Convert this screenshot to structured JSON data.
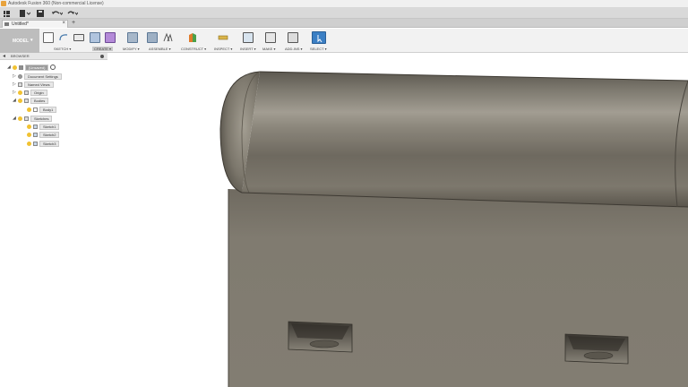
{
  "window": {
    "title": "Autodesk Fusion 360 (Non-commercial License)"
  },
  "document_tab": {
    "label": "Untitled*"
  },
  "ribbon": {
    "workspace": "MODEL",
    "groups": [
      {
        "label": "SKETCH ▾"
      },
      {
        "label": "CREATE ▾"
      },
      {
        "label": "MODIFY ▾"
      },
      {
        "label": "ASSEMBLE ▾"
      },
      {
        "label": "CONSTRUCT ▾"
      },
      {
        "label": "INSPECT ▾"
      },
      {
        "label": "INSERT ▾"
      },
      {
        "label": "MAKE ▾"
      },
      {
        "label": "ADD-INS ▾"
      },
      {
        "label": "SELECT ▾"
      }
    ]
  },
  "browser": {
    "title": "BROWSER",
    "root": "(Unsaved)",
    "items": [
      "Document Settings",
      "Named Views",
      "Origin",
      "Bodies",
      "Body1",
      "Sketches",
      "Sketch1",
      "Sketch2",
      "Sketch3"
    ]
  },
  "colors": {
    "model_body": "#7a756b",
    "model_shadow": "#5f5a51",
    "selected_tool": "#3b7fc4",
    "bulb": "#f1c232"
  }
}
